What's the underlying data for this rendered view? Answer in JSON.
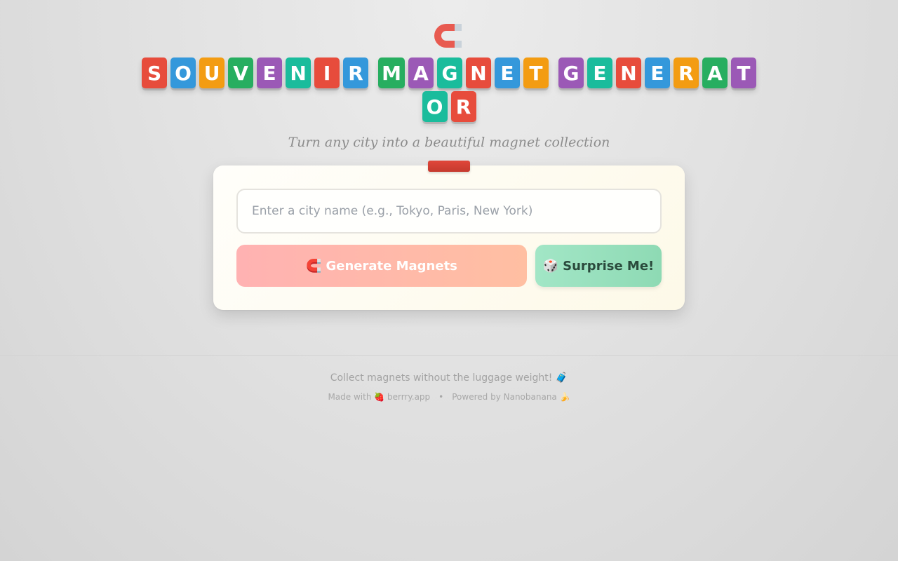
{
  "header": {
    "icon": "magnet-icon",
    "title_line1": [
      [
        "S",
        "O",
        "U",
        "V",
        "E",
        "N",
        "I",
        "R"
      ],
      [
        "M",
        "A",
        "G",
        "N",
        "E",
        "T"
      ],
      [
        "G",
        "E",
        "N",
        "E",
        "R",
        "A",
        "T"
      ]
    ],
    "title_line2": [
      [
        "O",
        "R"
      ]
    ],
    "tile_colors_line1": [
      [
        "#e74c3c",
        "#3498db",
        "#f39c12",
        "#27ae60",
        "#9b59b6",
        "#1abc9c",
        "#e74c3c",
        "#3498db"
      ],
      [
        "#27ae60",
        "#9b59b6",
        "#1abc9c",
        "#e74c3c",
        "#3498db",
        "#f39c12"
      ],
      [
        "#9b59b6",
        "#1abc9c",
        "#e74c3c",
        "#3498db",
        "#f39c12",
        "#27ae60",
        "#9b59b6"
      ]
    ],
    "tile_colors_line2": [
      [
        "#1abc9c",
        "#e74c3c"
      ]
    ],
    "subtitle": "Turn any city into a beautiful magnet collection"
  },
  "form": {
    "city_placeholder": "Enter a city name (e.g., Tokyo, Paris, New York)",
    "city_value": "",
    "generate_icon": "🧲",
    "generate_label": "Generate Magnets",
    "surprise_icon": "🎲",
    "surprise_label": "Surprise Me!"
  },
  "footer": {
    "tagline": "Collect magnets without the luggage weight! 🧳",
    "made_with": "Made with 🍓 berrry.app",
    "separator": "•",
    "powered_by": "Powered by Nanobanana 🍌"
  },
  "colors": {
    "clip": "#d9433a",
    "generate_button": "#ffb5ae",
    "surprise_button": "#98e0bd"
  }
}
